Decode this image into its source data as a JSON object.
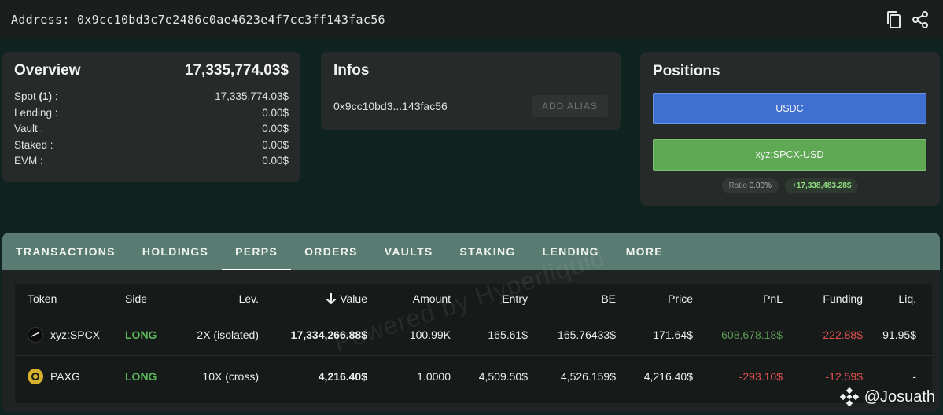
{
  "address_bar": {
    "label": "Address: 0x9cc10bd3c7e2486c0ae4623e4f7cc3ff143fac56",
    "copy_icon": "copy-icon",
    "share_icon": "share-icon"
  },
  "overview": {
    "title": "Overview",
    "total": "17,335,774.03$",
    "rows": [
      {
        "label_pre": "Spot ",
        "label_bold": "(1)",
        "label_post": " :",
        "value": "17,335,774.03$"
      },
      {
        "label_pre": "Lending :",
        "label_bold": "",
        "label_post": "",
        "value": "0.00$"
      },
      {
        "label_pre": "Vault :",
        "label_bold": "",
        "label_post": "",
        "value": "0.00$"
      },
      {
        "label_pre": "Staked :",
        "label_bold": "",
        "label_post": "",
        "value": "0.00$"
      },
      {
        "label_pre": "EVM :",
        "label_bold": "",
        "label_post": "",
        "value": "0.00$"
      }
    ]
  },
  "infos": {
    "title": "Infos",
    "short_address": "0x9cc10bd3...143fac56",
    "add_alias_label": "ADD ALIAS"
  },
  "positions": {
    "title": "Positions",
    "bars": [
      {
        "label": "USDC",
        "color": "#3f6fd0"
      },
      {
        "label": "xyz:SPCX-USD",
        "color": "#5fa955"
      }
    ],
    "ratio_label": "Ratio",
    "ratio_value": "0.00%",
    "pnl_chip": "+17,338,483.28$"
  },
  "tabs": [
    {
      "label": "TRANSACTIONS",
      "active": false
    },
    {
      "label": "HOLDINGS",
      "active": false
    },
    {
      "label": "PERPS",
      "active": true
    },
    {
      "label": "ORDERS",
      "active": false
    },
    {
      "label": "VAULTS",
      "active": false
    },
    {
      "label": "STAKING",
      "active": false
    },
    {
      "label": "LENDING",
      "active": false
    },
    {
      "label": "MORE",
      "active": false
    }
  ],
  "table": {
    "headers": {
      "token": "Token",
      "side": "Side",
      "lev": "Lev.",
      "value": "Value",
      "amount": "Amount",
      "entry": "Entry",
      "be": "BE",
      "price": "Price",
      "pnl": "PnL",
      "funding": "Funding",
      "liq": "Liq."
    },
    "sort_icon": "arrow-down-icon",
    "rows": [
      {
        "token": "xyz:SPCX",
        "token_icon": "spcx-icon",
        "side": "LONG",
        "lev": "2X (isolated)",
        "value": "17,334,266.88$",
        "amount": "100.99K",
        "entry": "165.61$",
        "be": "165.76433$",
        "price": "171.64$",
        "pnl": "608,678.18$",
        "funding": "-222.88$",
        "liq": "91.95$"
      },
      {
        "token": "PAXG",
        "token_icon": "paxg-icon",
        "side": "LONG",
        "lev": "10X (cross)",
        "value": "4,216.40$",
        "amount": "1.0000",
        "entry": "4,509.50$",
        "be": "4,526.159$",
        "price": "4,216.40$",
        "pnl": "-293.10$",
        "funding": "-12.59$",
        "liq": "-"
      }
    ]
  },
  "watermark": "Powered by Hyperliquid",
  "credit": "@Josuath",
  "colors": {
    "background": "#0f2420",
    "card": "#262a29",
    "tabbar": "#5a7b72",
    "positive": "#5cb65a",
    "negative": "#e35151"
  }
}
